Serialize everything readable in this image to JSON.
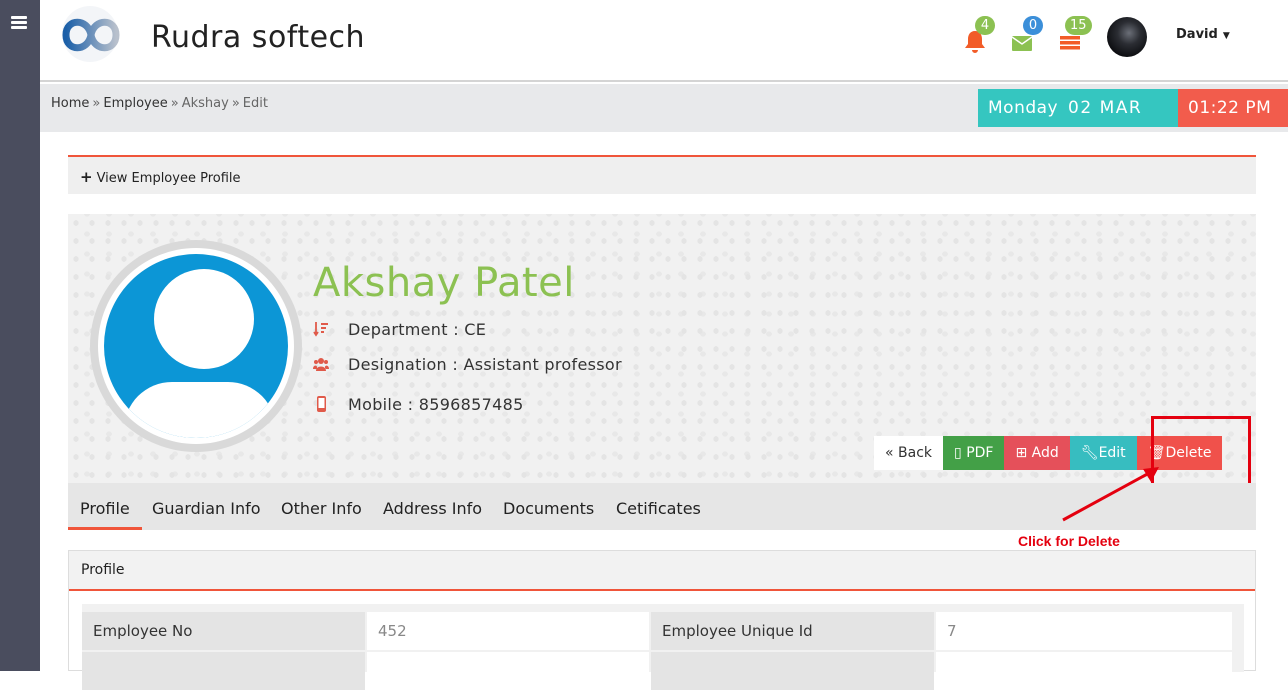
{
  "app": {
    "brand": "Rudra softech"
  },
  "header": {
    "notifications": {
      "count": "4",
      "color": "#8cc152"
    },
    "messages": {
      "count": "0",
      "color": "#3b8fd9"
    },
    "tasks": {
      "count": "15",
      "color": "#8cc152"
    },
    "user_name": "David"
  },
  "breadcrumb": {
    "home": "Home",
    "employee": "Employee",
    "person": "Akshay",
    "current": "Edit",
    "separator": "»"
  },
  "datetime": {
    "day": "Monday",
    "date": "02 MAR",
    "time": "01:22 PM"
  },
  "view_profile_label": "View Employee Profile",
  "profile": {
    "name": "Akshay Patel",
    "department": "Department : CE",
    "designation": "Designation : Assistant professor",
    "mobile": "Mobile : 8596857485"
  },
  "actions": {
    "back": "Back",
    "pdf": "PDF",
    "add": "Add",
    "edit": "Edit",
    "delete": "Delete"
  },
  "annotation": "Click for Delete",
  "tabs": [
    "Profile",
    "Guardian Info",
    "Other Info",
    "Address Info",
    "Documents",
    "Cetificates"
  ],
  "panel_title": "Profile",
  "fields": [
    {
      "label": "Employee No",
      "value": "452"
    },
    {
      "label": "Employee Unique Id",
      "value": "7"
    }
  ],
  "colors": {
    "accent": "#f0553a",
    "name_green": "#8cc152",
    "teal": "#35c6c0",
    "red": "#f25c4c"
  }
}
